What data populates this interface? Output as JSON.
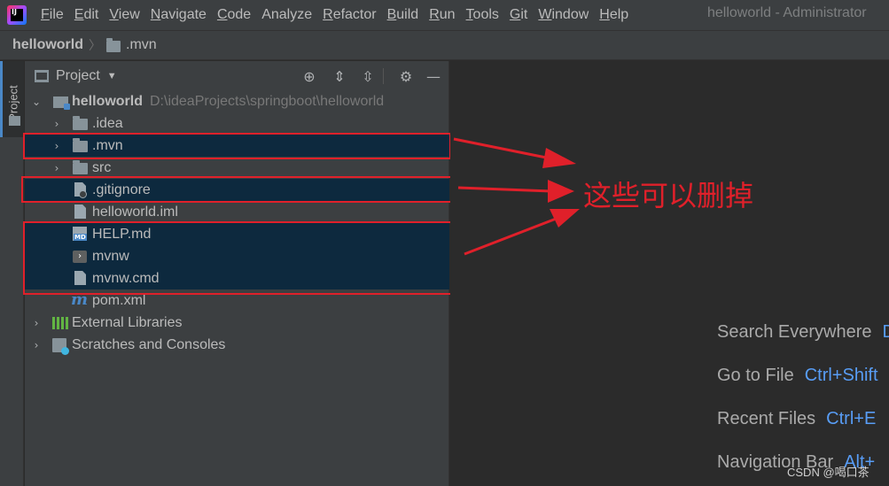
{
  "menubar": {
    "logo_text": "IJ",
    "items": [
      {
        "label": "File",
        "u": "F",
        "rest": "ile"
      },
      {
        "label": "Edit",
        "u": "E",
        "rest": "dit"
      },
      {
        "label": "View",
        "u": "V",
        "rest": "iew"
      },
      {
        "label": "Navigate",
        "u": "N",
        "rest": "avigate"
      },
      {
        "label": "Code",
        "u": "C",
        "rest": "ode"
      },
      {
        "label": "Analyze",
        "u": "",
        "rest": "Analyze"
      },
      {
        "label": "Refactor",
        "u": "R",
        "rest": "efactor"
      },
      {
        "label": "Build",
        "u": "B",
        "rest": "uild"
      },
      {
        "label": "Run",
        "u": "R",
        "rest": "un"
      },
      {
        "label": "Tools",
        "u": "T",
        "rest": "ools"
      },
      {
        "label": "Git",
        "u": "G",
        "rest": "it"
      },
      {
        "label": "Window",
        "u": "W",
        "rest": "indow"
      },
      {
        "label": "Help",
        "u": "H",
        "rest": "elp"
      }
    ],
    "window_title": "helloworld - Administrator"
  },
  "breadcrumb": {
    "root": "helloworld",
    "separator": "〉",
    "current": ".mvn"
  },
  "toolstrip": {
    "tab_label": "Project"
  },
  "panel": {
    "title": "Project",
    "caret": "▼",
    "icons": [
      "locate-icon",
      "expand-all-icon",
      "collapse-all-icon",
      "gear-icon",
      "minimize-icon"
    ]
  },
  "tree": {
    "root": {
      "name": "helloworld",
      "path": "D:\\ideaProjects\\springboot\\helloworld"
    },
    "items": [
      {
        "name": ".idea",
        "type": "folder"
      },
      {
        "name": ".mvn",
        "type": "folder"
      },
      {
        "name": "src",
        "type": "folder"
      },
      {
        "name": ".gitignore",
        "type": "ignore-file"
      },
      {
        "name": "helloworld.iml",
        "type": "iml-file"
      },
      {
        "name": "HELP.md",
        "type": "markdown-file"
      },
      {
        "name": "mvnw",
        "type": "shell-file"
      },
      {
        "name": "mvnw.cmd",
        "type": "cmd-file"
      },
      {
        "name": "pom.xml",
        "type": "maven-file"
      }
    ],
    "external_libraries": "External Libraries",
    "scratches": "Scratches and Consoles"
  },
  "editor_hints": [
    {
      "label": "Search Everywhere",
      "key": "D"
    },
    {
      "label": "Go to File",
      "key": "Ctrl+Shift"
    },
    {
      "label": "Recent Files",
      "key": "Ctrl+E"
    },
    {
      "label": "Navigation Bar",
      "key": "Alt+"
    }
  ],
  "annotation": {
    "text": "这些可以删掉",
    "color": "#e0202a"
  },
  "watermark": "CSDN @喝口茶",
  "colors": {
    "selection": "#0d293e",
    "highlight_box": "#e0202a",
    "shortcut": "#589df6"
  }
}
